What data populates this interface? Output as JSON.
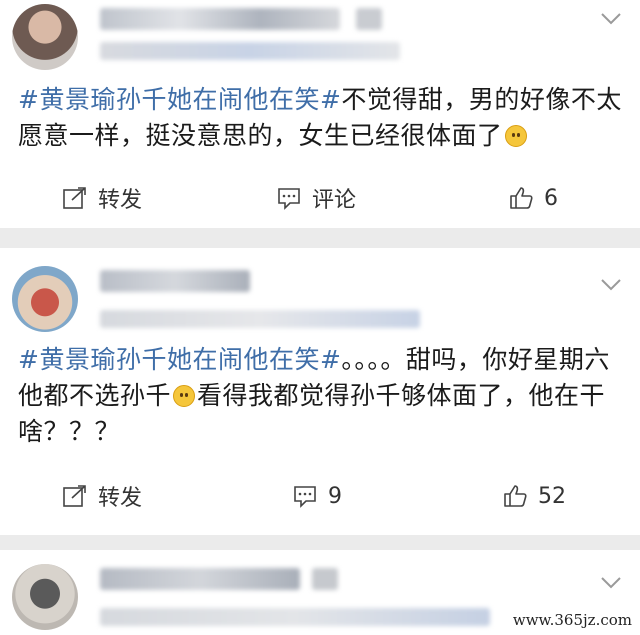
{
  "posts": [
    {
      "hashtag": "#黄景瑜孙千她在闹他在笑#",
      "text_before_emoji": "不觉得甜，男的好像不太愿意一样，挺没意思的，女生已经很体面了",
      "text_after_emoji": "",
      "actions": {
        "repost_label": "转发",
        "comment_label": "评论",
        "like_count": "6"
      }
    },
    {
      "hashtag": "#黄景瑜孙千她在闹他在笑#",
      "text_before_emoji": "。。。。甜吗，你好星期六他都不选孙千",
      "text_after_emoji": "看得我都觉得孙千够体面了，他在干啥？？？",
      "actions": {
        "repost_label": "转发",
        "comment_count": "9",
        "like_count": "52"
      }
    },
    {
      "hashtag": "",
      "text_before_emoji": "",
      "text_after_emoji": ""
    }
  ],
  "watermark": "www.365jz.com",
  "colors": {
    "hashtag": "#3f6ea8",
    "background": "#ebebeb",
    "card": "#ffffff"
  },
  "icons": [
    "repost-icon",
    "comment-icon",
    "like-icon",
    "chevron-down-icon",
    "emoji-icon"
  ]
}
